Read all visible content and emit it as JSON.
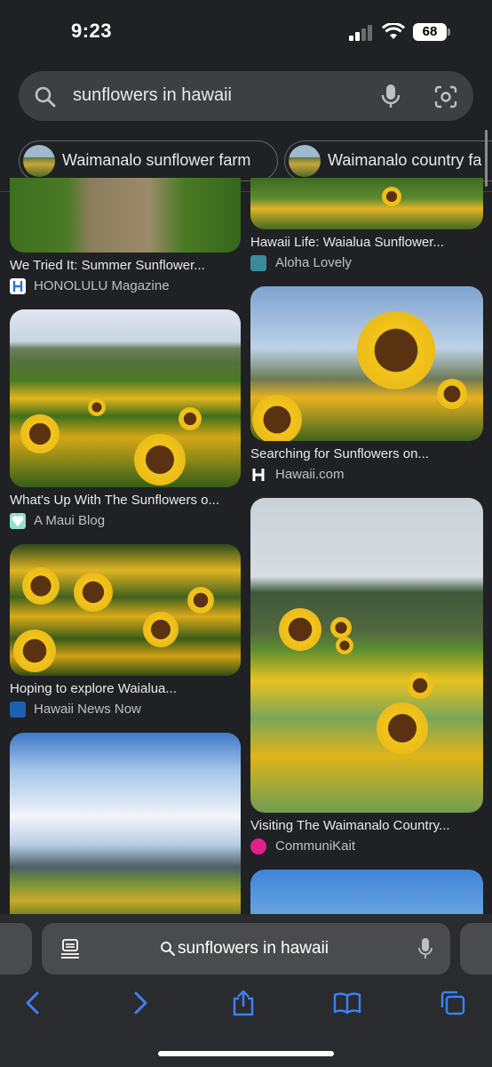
{
  "status_bar": {
    "time": "9:23",
    "battery": "68"
  },
  "search": {
    "query": "sunflowers in hawaii"
  },
  "chips": [
    {
      "label": "Waimanalo sunflower farm"
    },
    {
      "label": "Waimanalo country fa"
    }
  ],
  "results": [
    {
      "caption": "We Tried It: Summer Sunflower...",
      "source": "HONOLULU Magazine"
    },
    {
      "caption": "Hawaii Life: Waialua Sunflower...",
      "source": "Aloha Lovely"
    },
    {
      "caption": "What's Up With The Sunflowers o...",
      "source": "A Maui Blog"
    },
    {
      "caption": "Searching for Sunflowers on...",
      "source": "Hawaii.com"
    },
    {
      "caption": "Hoping to explore Waialua...",
      "source": "Hawaii News Now"
    },
    {
      "caption": "Visiting The Waimanalo Country...",
      "source": "CommuniKait"
    }
  ],
  "browser": {
    "url_text": "sunflowers in hawaii"
  },
  "colors": {
    "accent": "#3b82f6",
    "background": "#202124",
    "toolbar": "#2a2b2e"
  },
  "icons": [
    "search-icon",
    "mic-icon",
    "lens-icon",
    "reader-icon",
    "back-icon",
    "forward-icon",
    "share-icon",
    "bookmarks-icon",
    "tabs-icon"
  ]
}
